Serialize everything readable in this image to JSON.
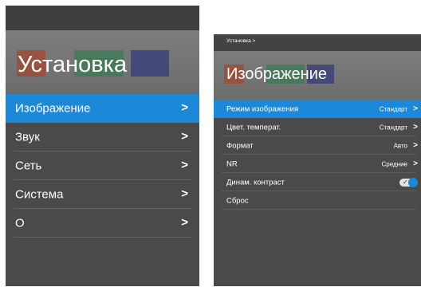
{
  "left": {
    "title": "Установка",
    "menu": [
      {
        "label": "Изображение",
        "arrow": ">"
      },
      {
        "label": "Звук",
        "arrow": ">"
      },
      {
        "label": "Сеть",
        "arrow": ">"
      },
      {
        "label": "Система",
        "arrow": ">"
      },
      {
        "label": "О",
        "arrow": ">"
      }
    ],
    "selected_index": 0
  },
  "right": {
    "breadcrumb": "Установка >",
    "title": "Изображение",
    "menu": [
      {
        "label": "Режим изображения",
        "value": "Стандарт",
        "arrow": ">"
      },
      {
        "label": "Цвет. температ.",
        "value": "Стандарт",
        "arrow": ">"
      },
      {
        "label": "Формат",
        "value": "Авто",
        "arrow": ">"
      },
      {
        "label": "NR",
        "value": "Средние",
        "arrow": ">"
      },
      {
        "label": "Динам. контраст",
        "toggle_on": true,
        "toggle_check": "✓"
      },
      {
        "label": "Сброс"
      }
    ],
    "selected_index": 0
  },
  "colors": {
    "panel_bg": "#4a4a4a",
    "selection": "#1e88d8",
    "header_bg": "#767676"
  }
}
